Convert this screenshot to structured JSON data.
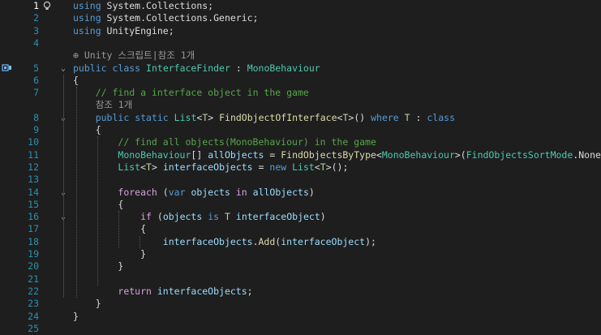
{
  "editor": {
    "current_line": 1,
    "lines": [
      {
        "n": "1",
        "t": [
          [
            "kw",
            "using"
          ],
          [
            "plain",
            " System.Collections;"
          ]
        ]
      },
      {
        "n": "2",
        "t": [
          [
            "kw",
            "using"
          ],
          [
            "plain",
            " System.Collections.Generic;"
          ]
        ]
      },
      {
        "n": "3",
        "t": [
          [
            "kw",
            "using"
          ],
          [
            "plain",
            " UnityEngine;"
          ]
        ]
      },
      {
        "n": "4",
        "t": []
      },
      {
        "n": "",
        "lens": true,
        "indent": 0,
        "t": [
          [
            "lens",
            "⊕ Unity 스크립트|참조 1개"
          ]
        ]
      },
      {
        "n": "5",
        "fold": true,
        "glyph": true,
        "t": [
          [
            "kw",
            "public"
          ],
          [
            "plain",
            " "
          ],
          [
            "kw",
            "class"
          ],
          [
            "plain",
            " "
          ],
          [
            "ty",
            "InterfaceFinder"
          ],
          [
            "plain",
            " : "
          ],
          [
            "ty",
            "MonoBehaviour"
          ]
        ]
      },
      {
        "n": "6",
        "t": [
          [
            "plain",
            "{"
          ]
        ]
      },
      {
        "n": "7",
        "t": [
          [
            "plain",
            "    "
          ],
          [
            "cm",
            "// find a interface object in the game"
          ]
        ]
      },
      {
        "n": "",
        "lens": true,
        "indent": 4,
        "t": [
          [
            "lens",
            "    참조 1개"
          ]
        ]
      },
      {
        "n": "8",
        "fold": true,
        "t": [
          [
            "plain",
            "    "
          ],
          [
            "kw",
            "public"
          ],
          [
            "plain",
            " "
          ],
          [
            "kw",
            "static"
          ],
          [
            "plain",
            " "
          ],
          [
            "ty",
            "List"
          ],
          [
            "plain",
            "<"
          ],
          [
            "tp",
            "T"
          ],
          [
            "plain",
            "> "
          ],
          [
            "fn",
            "FindObjectOfInterface"
          ],
          [
            "plain",
            "<"
          ],
          [
            "tp",
            "T"
          ],
          [
            "plain",
            ">() "
          ],
          [
            "kw",
            "where"
          ],
          [
            "plain",
            " "
          ],
          [
            "tp",
            "T"
          ],
          [
            "plain",
            " : "
          ],
          [
            "kw",
            "class"
          ]
        ]
      },
      {
        "n": "9",
        "t": [
          [
            "plain",
            "    {"
          ]
        ]
      },
      {
        "n": "10",
        "t": [
          [
            "plain",
            "        "
          ],
          [
            "cm",
            "// find all objects(MonoBehaviour) in the game"
          ]
        ]
      },
      {
        "n": "11",
        "t": [
          [
            "plain",
            "        "
          ],
          [
            "ty",
            "MonoBehaviour"
          ],
          [
            "plain",
            "[] "
          ],
          [
            "vr",
            "allObjects"
          ],
          [
            "plain",
            " = "
          ],
          [
            "fn",
            "FindObjectsByType"
          ],
          [
            "plain",
            "<"
          ],
          [
            "ty",
            "MonoBehaviour"
          ],
          [
            "plain",
            ">("
          ],
          [
            "ty",
            "FindObjectsSortMode"
          ],
          [
            "plain",
            ".None);"
          ]
        ]
      },
      {
        "n": "12",
        "t": [
          [
            "plain",
            "        "
          ],
          [
            "ty",
            "List"
          ],
          [
            "plain",
            "<"
          ],
          [
            "tp",
            "T"
          ],
          [
            "plain",
            "> "
          ],
          [
            "vr",
            "interfaceObjects"
          ],
          [
            "plain",
            " = "
          ],
          [
            "kw",
            "new"
          ],
          [
            "plain",
            " "
          ],
          [
            "ty",
            "List"
          ],
          [
            "plain",
            "<"
          ],
          [
            "tp",
            "T"
          ],
          [
            "plain",
            ">();"
          ]
        ]
      },
      {
        "n": "13",
        "t": []
      },
      {
        "n": "14",
        "fold": true,
        "t": [
          [
            "plain",
            "        "
          ],
          [
            "ctl",
            "foreach"
          ],
          [
            "plain",
            " ("
          ],
          [
            "kw",
            "var"
          ],
          [
            "plain",
            " "
          ],
          [
            "vr",
            "objects"
          ],
          [
            "plain",
            " "
          ],
          [
            "ctl",
            "in"
          ],
          [
            "plain",
            " "
          ],
          [
            "vr",
            "allObjects"
          ],
          [
            "plain",
            ")"
          ]
        ]
      },
      {
        "n": "15",
        "t": [
          [
            "plain",
            "        {"
          ]
        ]
      },
      {
        "n": "16",
        "fold": true,
        "t": [
          [
            "plain",
            "            "
          ],
          [
            "ctl",
            "if"
          ],
          [
            "plain",
            " ("
          ],
          [
            "vr",
            "objects"
          ],
          [
            "plain",
            " "
          ],
          [
            "kw",
            "is"
          ],
          [
            "plain",
            " "
          ],
          [
            "tp",
            "T"
          ],
          [
            "plain",
            " "
          ],
          [
            "vr",
            "interfaceObject"
          ],
          [
            "plain",
            ")"
          ]
        ]
      },
      {
        "n": "17",
        "t": [
          [
            "plain",
            "            {"
          ]
        ]
      },
      {
        "n": "18",
        "t": [
          [
            "plain",
            "                "
          ],
          [
            "vr",
            "interfaceObjects"
          ],
          [
            "plain",
            "."
          ],
          [
            "fn",
            "Add"
          ],
          [
            "plain",
            "("
          ],
          [
            "vr",
            "interfaceObject"
          ],
          [
            "plain",
            ");"
          ]
        ]
      },
      {
        "n": "19",
        "t": [
          [
            "plain",
            "            }"
          ]
        ]
      },
      {
        "n": "20",
        "t": [
          [
            "plain",
            "        }"
          ]
        ]
      },
      {
        "n": "21",
        "t": []
      },
      {
        "n": "22",
        "t": [
          [
            "plain",
            "        "
          ],
          [
            "ctl",
            "return"
          ],
          [
            "plain",
            " "
          ],
          [
            "vr",
            "interfaceObjects"
          ],
          [
            "plain",
            ";"
          ]
        ]
      },
      {
        "n": "23",
        "t": [
          [
            "plain",
            "    }"
          ]
        ]
      },
      {
        "n": "24",
        "t": [
          [
            "plain",
            "}"
          ]
        ]
      },
      {
        "n": "25",
        "t": []
      }
    ]
  },
  "colors": {
    "background": "#1e1e1e",
    "keyword": "#569cd6",
    "type": "#4ec9b0",
    "comment": "#57a64a",
    "line_number": "#2b91af"
  }
}
